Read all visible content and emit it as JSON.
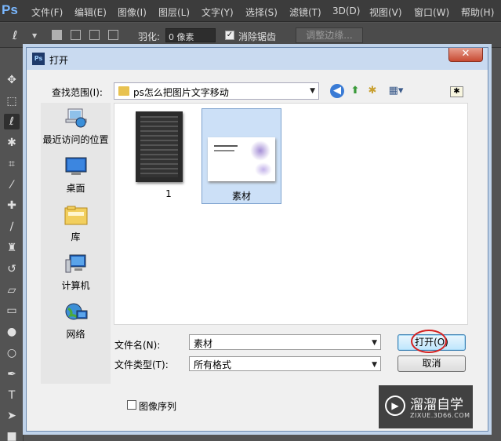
{
  "app": {
    "logo": "Ps",
    "menu": [
      "文件(F)",
      "编辑(E)",
      "图像(I)",
      "图层(L)",
      "文字(Y)",
      "选择(S)",
      "滤镜(T)",
      "3D(D)",
      "视图(V)",
      "窗口(W)",
      "帮助(H)"
    ]
  },
  "options_bar": {
    "feather_label": "羽化:",
    "feather_value": "0 像素",
    "antialias_label": "消除锯齿",
    "antialias_checked": true,
    "refine_edge_label": "调整边缘..."
  },
  "dialog": {
    "title": "打开",
    "close_glyph": "✕",
    "look_in_label": "查找范围(I):",
    "look_in_value": "ps怎么把图片文字移动",
    "places": [
      {
        "label": "最近访问的位置",
        "icon": "recent-places-icon"
      },
      {
        "label": "桌面",
        "icon": "desktop-icon"
      },
      {
        "label": "库",
        "icon": "libraries-icon"
      },
      {
        "label": "计算机",
        "icon": "computer-icon"
      },
      {
        "label": "网络",
        "icon": "network-icon"
      }
    ],
    "files": [
      {
        "name": "1",
        "selected": false
      },
      {
        "name": "素材",
        "selected": true
      }
    ],
    "file_name_label": "文件名(N):",
    "file_name_value": "素材",
    "file_type_label": "文件类型(T):",
    "file_type_value": "所有格式",
    "open_button": "打开(O)",
    "cancel_button": "取消",
    "image_sequence_label": "图像序列",
    "image_sequence_checked": false
  },
  "watermark": {
    "title": "溜溜自学",
    "subtitle": "ZIXUE.3D66.COM"
  }
}
